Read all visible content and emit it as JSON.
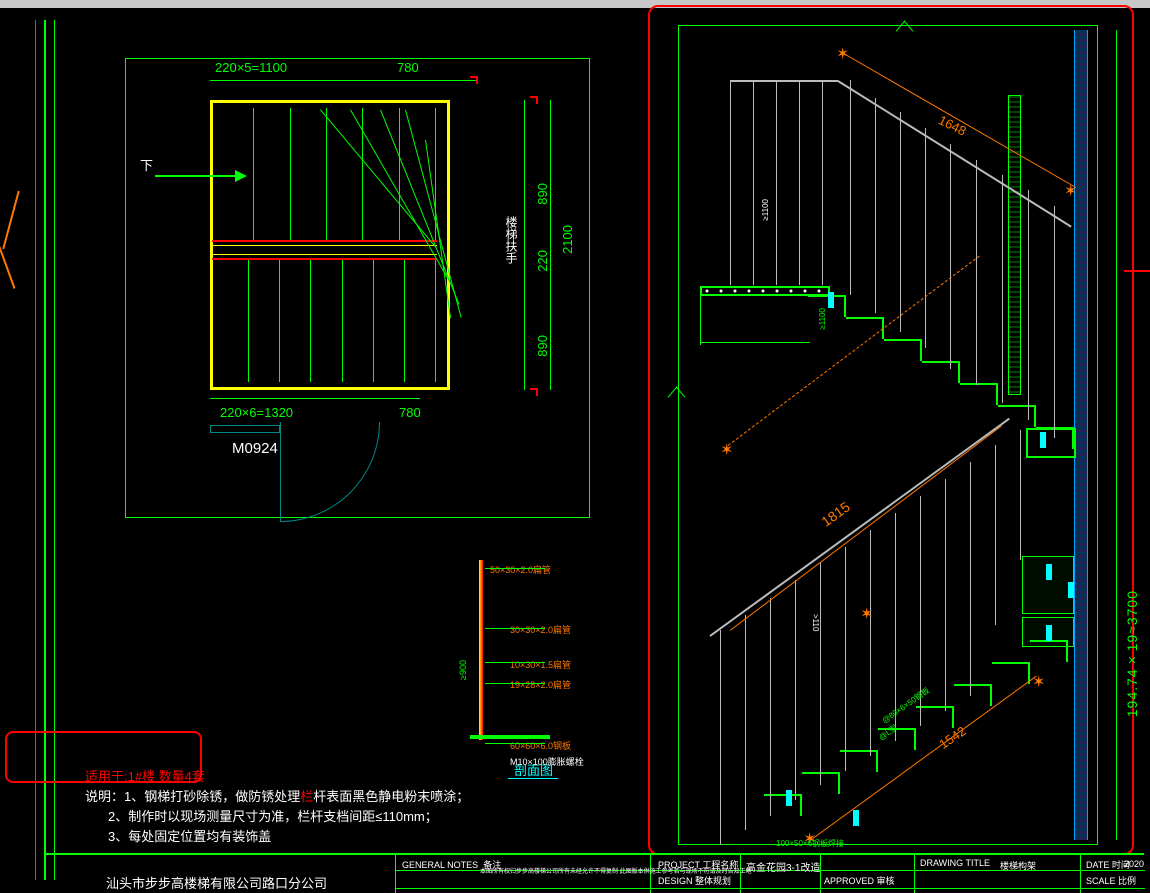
{
  "plan": {
    "dim_top1": "220×5=1100",
    "dim_top2": "780",
    "dim_bot1": "220×6=1320",
    "dim_bot2": "780",
    "door": "M0924",
    "down_label": "下",
    "right_dim1": "890",
    "right_dim2": "220",
    "right_dim3": "890",
    "right_total": "2100",
    "right_label": "楼梯扶手"
  },
  "section": {
    "title": "剖面图",
    "label1": "50×30×2.0扁管",
    "label2": "30×30×2.0扁管",
    "label3": "10×30×1.5扁管",
    "label4": "19×28×2.0扁管",
    "label5": "60×60×6.0钢板",
    "label6": "M10×100膨胀螺栓",
    "height": "≥900"
  },
  "notes": {
    "heading": "适用于:1#楼  数量4套",
    "line1_pre": "说明：1、钢梯打砂除锈，做防锈处理",
    "line1_red": "栏",
    "line1_post": "杆表面黑色静电粉末喷涂；",
    "line2": "2、制作时以现场测量尺寸为准，栏杆支档间距≤110mm；",
    "line3": "3、每处固定位置均有装饰盖"
  },
  "company": "汕头市步步高楼梯有限公司路口分公司",
  "elevation": {
    "dim1": "1648",
    "dim2": "1815",
    "dim3": "1542",
    "outer_dim": "194.74×19≈3700",
    "note1": "@80×6×50钢板",
    "note2": "@L型",
    "note3": "100×50×6钢板焊接",
    "rail_h1": "≥1100",
    "rail_h2": ">110",
    "step_dim": "≥1100"
  },
  "titleblock": {
    "gn": "GENERAL NOTES",
    "gn_cn": "备注",
    "pj": "PROJECT 工程名称",
    "pjv": "高金花园3-1改造",
    "dt": "DRAWING TITLE",
    "dtv": "楼梯构架",
    "date": "DATE 时间",
    "datev": "2020",
    "design": "DESIGN 整体规划",
    "approved": "APPROVED 审核",
    "scale": "SCALE 比例",
    "small": "本图所有权归步步高楼梯公司所有未经允许不得复制\n此图版本供施工参考若与现场不符请及时告知工地"
  }
}
